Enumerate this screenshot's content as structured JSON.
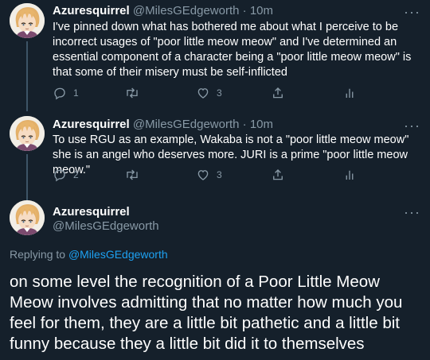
{
  "colors": {
    "background": "#15202b",
    "secondary_text": "#8899a6",
    "link": "#1da1f2",
    "thread_line": "#3d5466"
  },
  "tweets": [
    {
      "display_name": "Azuresquirrel",
      "handle": "@MilesGEdgeworth",
      "separator": "·",
      "time": "10m",
      "more": "···",
      "text": "I've pinned down what has bothered me about what I perceive to be incorrect usages of \"poor little meow meow\" and I've determined an essential component of a character being a \"poor little meow meow\" is that some of their misery must be self-inflicted",
      "reply_count": "1",
      "retweet_count": "",
      "like_count": "3"
    },
    {
      "display_name": "Azuresquirrel",
      "handle": "@MilesGEdgeworth",
      "separator": "·",
      "time": "10m",
      "more": "···",
      "text": "To use RGU as an example, Wakaba is not a \"poor little meow meow\" she is an angel who deserves more. JURI is a prime \"poor little meow meow.\"",
      "reply_count": "2",
      "retweet_count": "",
      "like_count": "3"
    }
  ],
  "main_tweet": {
    "display_name": "Azuresquirrel",
    "handle": "@MilesGEdgeworth",
    "more": "···",
    "replying_prefix": "Replying to",
    "replying_to": "@MilesGEdgeworth",
    "text": "on some level the recognition of a Poor Little Meow Meow involves admitting that no matter how much you feel for them, they are a little bit pathetic and a little bit funny because they a little bit did it to themselves"
  },
  "icons": {
    "reply": "reply-icon",
    "retweet": "retweet-icon",
    "like": "heart-icon",
    "share": "share-icon",
    "analytics": "analytics-icon",
    "avatar": "avatar-image"
  }
}
